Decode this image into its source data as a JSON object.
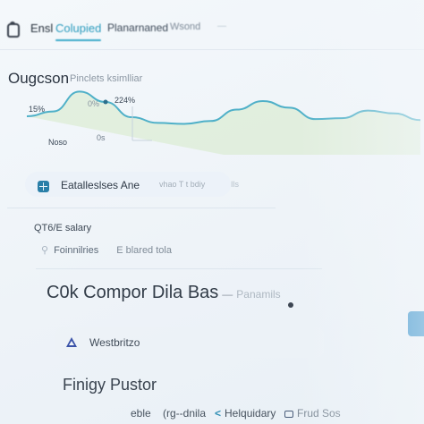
{
  "tabs": [
    {
      "label": "Ensl"
    },
    {
      "label": "Colupied"
    },
    {
      "label": "Planarnaned"
    },
    {
      "label": "Wsond"
    },
    {
      "label": "—"
    }
  ],
  "section": {
    "title": "Ougcson",
    "subtitle": "Pinclets ksimlliar"
  },
  "chart_data": {
    "type": "line",
    "title": "",
    "xlabel": "",
    "ylabel": "",
    "labels": [
      "15%",
      "0%",
      "224%",
      "Noso",
      "0s"
    ],
    "series": [
      {
        "values": [
          62,
          52,
          10,
          32,
          64,
          76,
          78,
          72,
          48,
          30,
          44,
          68,
          66,
          50,
          56,
          70
        ]
      }
    ],
    "ylim": [
      0,
      100
    ],
    "grid": false,
    "colors": {
      "line": "#4fb0c8",
      "area": "#d6e9c8"
    }
  },
  "pill": {
    "label": "Eatalleslses Ane",
    "detail": "vhao  T  t bdiy",
    "tail": "Ils"
  },
  "salary": {
    "label": "QT6/E salary",
    "item_left": "Foinnilries",
    "item_right": "E  blared tola"
  },
  "compare": {
    "title": "C0k Compor Dila Bas",
    "dash": "—",
    "muted": "Panamils"
  },
  "west": {
    "label": "Westbritzo"
  },
  "footer": {
    "title": "Finigy Pustor",
    "items": [
      "eble",
      "(rg--dnila",
      "Helquidary",
      "Frud Sos"
    ]
  }
}
